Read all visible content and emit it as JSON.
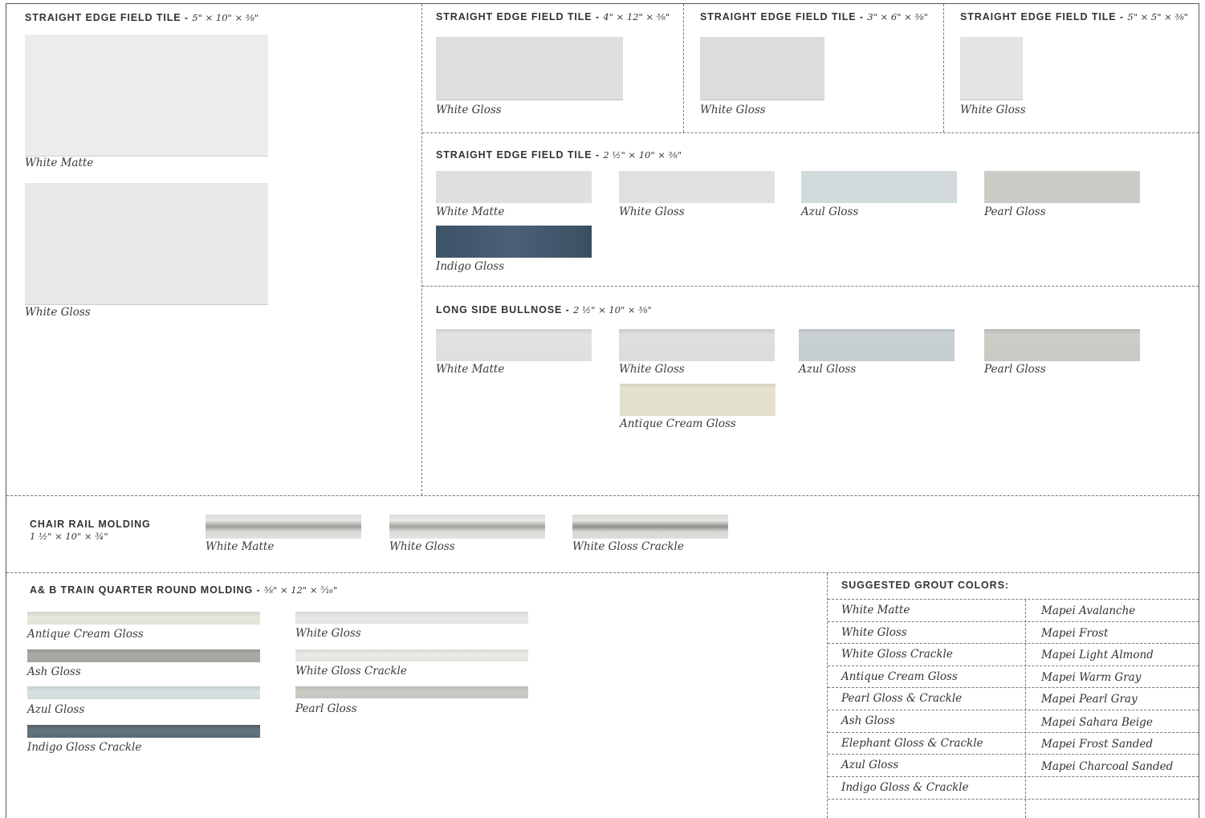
{
  "sections": {
    "s5x10": {
      "title": "STRAIGHT EDGE FIELD TILE",
      "dim": "5\" × 10\" × ⅜\"",
      "tiles": [
        {
          "label": "White Matte",
          "color": "#ececeb"
        },
        {
          "label": "White Gloss",
          "color": "#e9e9e7"
        }
      ]
    },
    "s4x12": {
      "title": "STRAIGHT EDGE FIELD TILE",
      "dim": "4\" × 12\" × ⅜\"",
      "tiles": [
        {
          "label": "White Gloss",
          "color": "#dededd"
        }
      ]
    },
    "s3x6": {
      "title": "STRAIGHT EDGE FIELD TILE",
      "dim": "3\" × 6\" × ⅜\"",
      "tiles": [
        {
          "label": "White Gloss",
          "color": "#dcdcdb"
        }
      ]
    },
    "s5x5": {
      "title": "STRAIGHT EDGE FIELD TILE",
      "dim": "5\" × 5\" × ⅜\"",
      "tiles": [
        {
          "label": "White Gloss",
          "color": "#e4e4e3"
        }
      ]
    },
    "s2x10": {
      "title": "STRAIGHT EDGE FIELD TILE",
      "dim": "2 ½\" × 10\" × ⅜\"",
      "tiles": [
        {
          "label": "White Matte",
          "color": "#dfdfde"
        },
        {
          "label": "White Gloss",
          "color": "#e0e0df"
        },
        {
          "label": "Azul Gloss",
          "color": "#d2dadb"
        },
        {
          "label": "Pearl Gloss",
          "color": "#cbcbc6"
        },
        {
          "label": "Indigo Gloss",
          "color": "#3f5568"
        }
      ]
    },
    "bullnose": {
      "title": "LONG SIDE BULLNOSE",
      "dim": "2 ½\" × 10\" × ⅜\"",
      "tiles": [
        {
          "label": "White Matte",
          "color": "#dfdfde"
        },
        {
          "label": "White Gloss",
          "color": "#dcdcdb"
        },
        {
          "label": "Azul Gloss",
          "color": "#c5cdcf"
        },
        {
          "label": "Pearl Gloss",
          "color": "#c9c8c3"
        },
        {
          "label": "Antique Cream Gloss",
          "color": "#e3dfcd"
        }
      ]
    },
    "chair": {
      "title": "CHAIR RAIL MOLDING",
      "dim": "1 ½\" × 10\" × ¾\"",
      "tiles": [
        {
          "label": "White Matte",
          "color": "#d4d4d2"
        },
        {
          "label": "White Gloss",
          "color": "#d6d6d4"
        },
        {
          "label": "White Gloss Crackle",
          "color": "#cfcfcc"
        }
      ]
    },
    "quarter": {
      "title": "A& B TRAIN QUARTER ROUND MOLDING",
      "dim": "⅝\" × 12\" × ⁵⁄₁₆\"",
      "tiles": [
        {
          "label": "Antique Cream Gloss",
          "color": "#e3e2d8"
        },
        {
          "label": "Ash Gloss",
          "color": "#a4a4a1"
        },
        {
          "label": "Azul Gloss",
          "color": "#d3dbdd"
        },
        {
          "label": "Indigo Gloss Crackle",
          "color": "#5a6a77"
        },
        {
          "label": "White Gloss",
          "color": "#e2e2e1"
        },
        {
          "label": "White Gloss Crackle",
          "color": "#e4e4e1"
        },
        {
          "label": "Pearl Gloss",
          "color": "#c7c7c2"
        }
      ]
    }
  },
  "grout": {
    "title": "SUGGESTED GROUT COLORS:",
    "rows": [
      {
        "tile": "White Matte",
        "grout": "Mapei Avalanche"
      },
      {
        "tile": "White Gloss",
        "grout": "Mapei Frost"
      },
      {
        "tile": "White Gloss Crackle",
        "grout": "Mapei Light Almond"
      },
      {
        "tile": "Antique Cream Gloss",
        "grout": "Mapei Warm Gray"
      },
      {
        "tile": "Pearl Gloss & Crackle",
        "grout": "Mapei Pearl Gray"
      },
      {
        "tile": "Ash Gloss",
        "grout": "Mapei Sahara Beige"
      },
      {
        "tile": "Elephant Gloss & Crackle",
        "grout": "Mapei Frost Sanded"
      },
      {
        "tile": "Azul Gloss",
        "grout": "Mapei Charcoal Sanded"
      },
      {
        "tile": "Indigo Gloss  & Crackle",
        "grout": ""
      }
    ]
  }
}
